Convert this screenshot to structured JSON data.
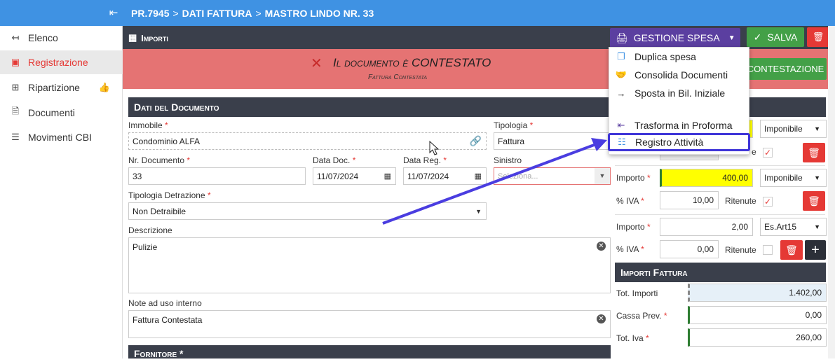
{
  "sidebar": {
    "collapse_icon": "collapse-left-icon",
    "items": [
      {
        "label": "Elenco",
        "icon": "back-arrow-icon"
      },
      {
        "label": "Registrazione",
        "icon": "id-card-icon"
      },
      {
        "label": "Ripartizione",
        "icon": "split-icon"
      },
      {
        "label": "Documenti",
        "icon": "pdf-icon"
      },
      {
        "label": "Movimenti CBI",
        "icon": "list-icon"
      }
    ]
  },
  "breadcrumb": [
    "PR.7945",
    "DATI FATTURA",
    "MASTRO LINDO NR. 33"
  ],
  "toolbar": {
    "section_title": "Importi",
    "gestione_label": "GESTIONE SPESA",
    "salva_label": "SALVA"
  },
  "banner": {
    "title": "Il documento è CONTESTATO",
    "subtitle": "Fattura Contestata",
    "button_label": "CONTESTAZIONE"
  },
  "menu": {
    "items": [
      {
        "label": "Duplica spesa",
        "icon": "copy-icon"
      },
      {
        "label": "Consolida Documenti",
        "icon": "handshake-icon"
      },
      {
        "label": "Sposta in Bil. Iniziale",
        "icon": "arrow-right-icon"
      },
      {
        "label": "Trasforma in Proforma",
        "icon": "arrow-left-bar-icon"
      },
      {
        "label": "Registro Attività",
        "icon": "list-detail-icon"
      }
    ]
  },
  "documento": {
    "title": "Dati del Documento",
    "immobile_label": "Immobile",
    "immobile_value": "Condominio ALFA",
    "tipologia_label": "Tipologia",
    "tipologia_value": "Fattura",
    "nr_label": "Nr. Documento",
    "nr_value": "33",
    "datadoc_label": "Data Doc.",
    "datadoc_value": "11/07/2024",
    "datareg_label": "Data Reg.",
    "datareg_value": "11/07/2024",
    "sinistro_label": "Sinistro",
    "sinistro_placeholder": "Seleziona...",
    "detrazione_label": "Tipologia Detrazione",
    "detrazione_value": "Non Detraibile",
    "descrizione_label": "Descrizione",
    "descrizione_value": "Pulizie",
    "note_label": "Note ad uso interno",
    "note_value": "Fattura Contestata"
  },
  "fornitore": {
    "title": "Fornitore *"
  },
  "importi": {
    "rows": [
      {
        "importo_label": "Importo",
        "importo": "400,00",
        "tipo": "Imponibile",
        "iva_label": "% IVA",
        "iva": "10,00",
        "ritenute_label": "Ritenute",
        "checked": "✓"
      },
      {
        "importo_label": "Importo",
        "importo": "2,00",
        "tipo": "Es.Art15",
        "iva_label": "% IVA",
        "iva": "0,00",
        "ritenute_label": "Ritenute",
        "checked": ""
      }
    ],
    "top_tipo": "Imponibile",
    "top_ritenute": "e",
    "top_checked": "✓"
  },
  "totali": {
    "title": "Importi Fattura",
    "tot_importi_label": "Tot. Importi",
    "tot_importi": "1.402,00",
    "cassa_label": "Cassa Prev.",
    "cassa": "0,00",
    "iva_label": "Tot. Iva",
    "iva": "260,00"
  }
}
